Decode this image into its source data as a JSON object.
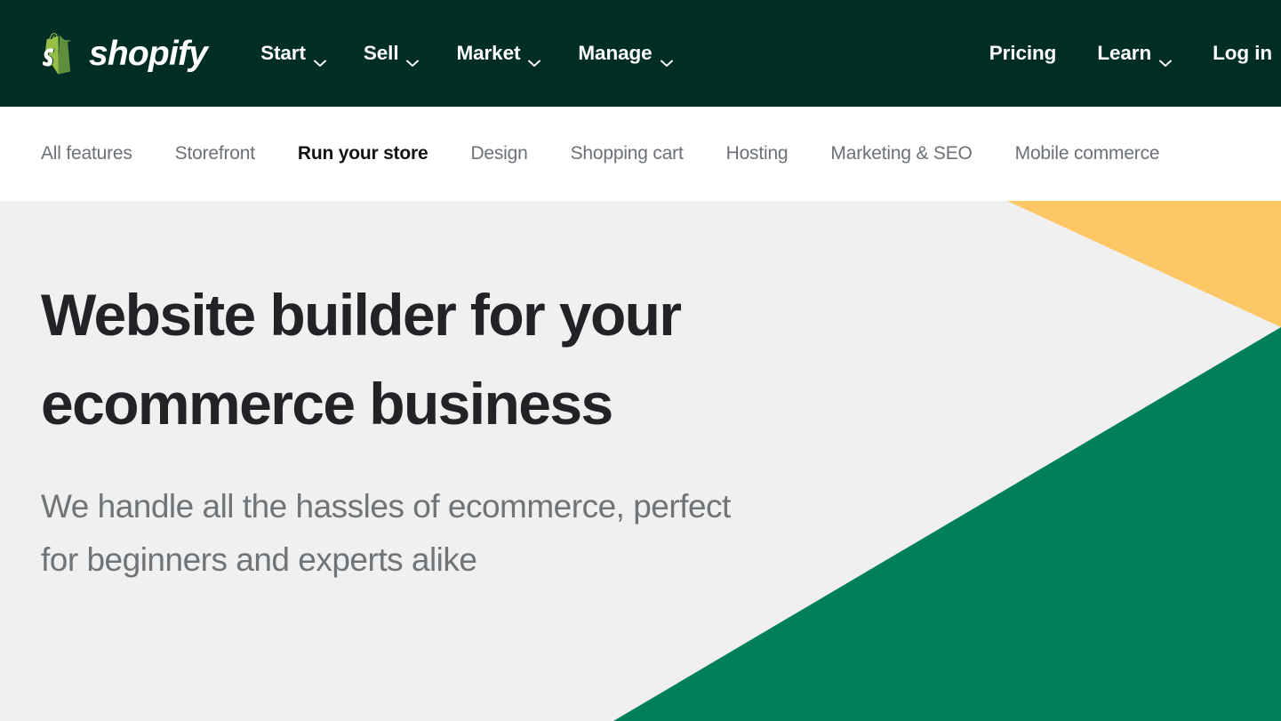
{
  "brand": {
    "name": "shopify",
    "logo_icon": "shopify-bag-icon",
    "logo_colors": {
      "bag_light": "#95BF47",
      "bag_dark": "#5E8E3E",
      "letter": "#FFFFFF"
    }
  },
  "colors": {
    "topnav_bg": "#002E25",
    "subnav_bg": "#FFFFFF",
    "hero_bg": "#F0F0F0",
    "accent_yellow": "#FDC765",
    "accent_green": "#00805A",
    "heading": "#212326",
    "body_text": "#6E7478",
    "nav_inactive": "#6B7177",
    "nav_active": "#111316"
  },
  "topnav": {
    "primary_items": [
      {
        "label": "Start",
        "has_dropdown": true,
        "icon": "chevron-down-icon"
      },
      {
        "label": "Sell",
        "has_dropdown": true,
        "icon": "chevron-down-icon"
      },
      {
        "label": "Market",
        "has_dropdown": true,
        "icon": "chevron-down-icon"
      },
      {
        "label": "Manage",
        "has_dropdown": true,
        "icon": "chevron-down-icon"
      }
    ],
    "secondary_items": [
      {
        "label": "Pricing",
        "has_dropdown": false
      },
      {
        "label": "Learn",
        "has_dropdown": true,
        "icon": "chevron-down-icon"
      },
      {
        "label": "Log in",
        "has_dropdown": false
      }
    ]
  },
  "subnav": {
    "items": [
      {
        "label": "All features",
        "active": false
      },
      {
        "label": "Storefront",
        "active": false
      },
      {
        "label": "Run your store",
        "active": true
      },
      {
        "label": "Design",
        "active": false
      },
      {
        "label": "Shopping cart",
        "active": false
      },
      {
        "label": "Hosting",
        "active": false
      },
      {
        "label": "Marketing & SEO",
        "active": false
      },
      {
        "label": "Mobile commerce",
        "active": false
      }
    ]
  },
  "hero": {
    "title": "Website builder for your ecommerce business",
    "subtitle": "We handle all the hassles of ecommerce, perfect for beginners and experts alike"
  }
}
